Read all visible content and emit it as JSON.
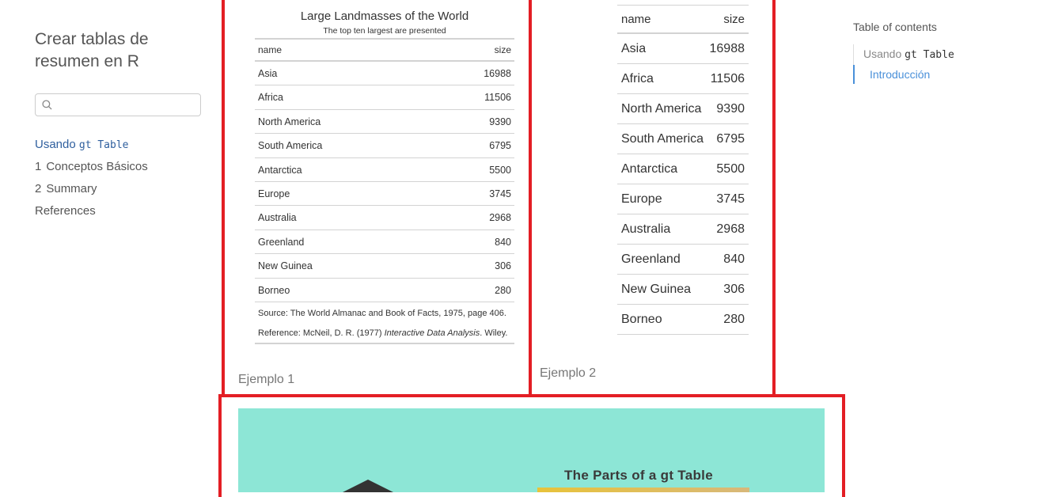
{
  "sidebar": {
    "title": "Crear tablas de resumen en R",
    "search_placeholder": "",
    "nav": [
      {
        "prefix": "Usando ",
        "code": "gt Table",
        "num": "",
        "label": ""
      },
      {
        "num": "1",
        "label": "Conceptos Básicos"
      },
      {
        "num": "2",
        "label": "Summary"
      },
      {
        "num": "",
        "label": "References"
      }
    ]
  },
  "toc": {
    "title": "Table of contents",
    "items": [
      {
        "prefix": "Usando ",
        "code": "gt Table"
      },
      {
        "label": "Introducción"
      }
    ]
  },
  "example1": {
    "title": "Large Landmasses of the World",
    "subtitle": "The top ten largest are presented",
    "col_name": "name",
    "col_size": "size",
    "rows": [
      {
        "name": "Asia",
        "size": "16988"
      },
      {
        "name": "Africa",
        "size": "11506"
      },
      {
        "name": "North America",
        "size": "9390"
      },
      {
        "name": "South America",
        "size": "6795"
      },
      {
        "name": "Antarctica",
        "size": "5500"
      },
      {
        "name": "Europe",
        "size": "3745"
      },
      {
        "name": "Australia",
        "size": "2968"
      },
      {
        "name": "Greenland",
        "size": "840"
      },
      {
        "name": "New Guinea",
        "size": "306"
      },
      {
        "name": "Borneo",
        "size": "280"
      }
    ],
    "source_note": "Source: The World Almanac and Book of Facts, 1975, page 406.",
    "reference_prefix": "Reference: McNeil, D. R. (1977) ",
    "reference_title": "Interactive Data Analysis",
    "reference_suffix": ". Wiley.",
    "caption": "Ejemplo 1"
  },
  "example2": {
    "col_name": "name",
    "col_size": "size",
    "rows": [
      {
        "name": "Asia",
        "size": "16988"
      },
      {
        "name": "Africa",
        "size": "11506"
      },
      {
        "name": "North America",
        "size": "9390"
      },
      {
        "name": "South America",
        "size": "6795"
      },
      {
        "name": "Antarctica",
        "size": "5500"
      },
      {
        "name": "Europe",
        "size": "3745"
      },
      {
        "name": "Australia",
        "size": "2968"
      },
      {
        "name": "Greenland",
        "size": "840"
      },
      {
        "name": "New Guinea",
        "size": "306"
      },
      {
        "name": "Borneo",
        "size": "280"
      }
    ],
    "caption": "Ejemplo 2"
  },
  "image_panel": {
    "title": "The Parts of a gt Table",
    "background": "#8de6d6"
  },
  "colors": {
    "highlight_frame": "#e31e24",
    "nav_active": "#2f5f9e",
    "toc_active": "#4a90d9"
  }
}
